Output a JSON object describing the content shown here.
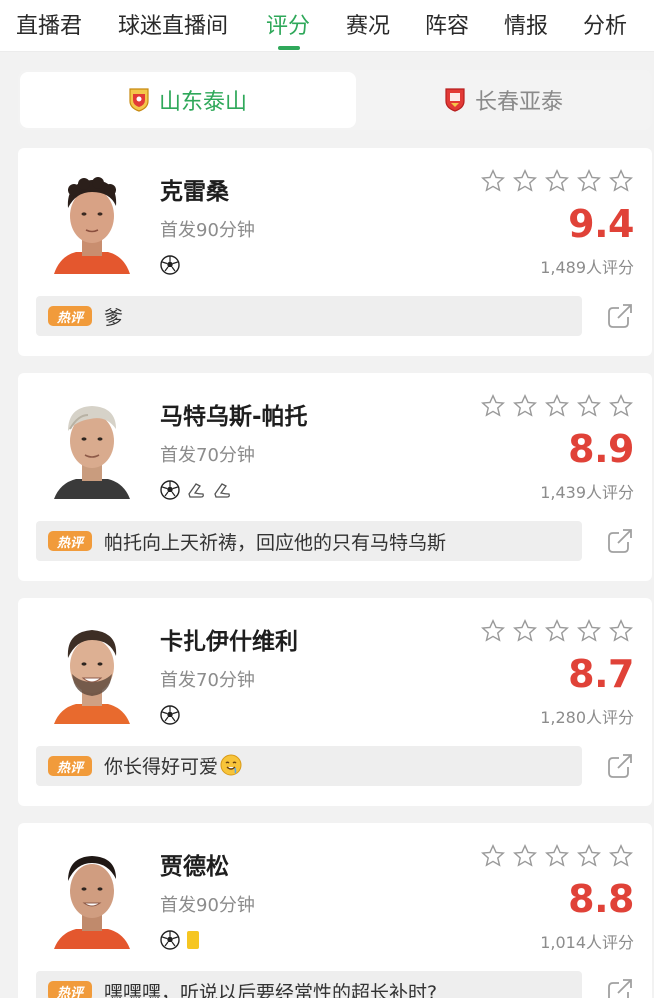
{
  "nav": {
    "tabs": [
      {
        "label": "直播君",
        "active": false
      },
      {
        "label": "球迷直播间",
        "active": false
      },
      {
        "label": "评分",
        "active": true
      },
      {
        "label": "赛况",
        "active": false
      },
      {
        "label": "阵容",
        "active": false
      },
      {
        "label": "情报",
        "active": false
      },
      {
        "label": "分析",
        "active": false
      }
    ],
    "accent_color": "#2fa85a"
  },
  "teams": {
    "home": {
      "name": "山东泰山",
      "selected": true,
      "badge_color": "#e8a21a"
    },
    "away": {
      "name": "长春亚泰",
      "selected": false,
      "badge_color": "#e23a36"
    }
  },
  "players": [
    {
      "name": "克雷桑",
      "start": "首发90分钟",
      "score": "9.4",
      "rating_count": "1,489人评分",
      "stars": 0,
      "icons": [
        "ball-icon"
      ],
      "hot_label": "热评",
      "hot_comment": "爹",
      "emoji": ""
    },
    {
      "name": "马特乌斯-帕托",
      "start": "首发70分钟",
      "score": "8.9",
      "rating_count": "1,439人评分",
      "stars": 0,
      "icons": [
        "ball-icon",
        "boot-icon",
        "boot-icon"
      ],
      "hot_label": "热评",
      "hot_comment": "帕托向上天祈祷，回应他的只有马特乌斯",
      "emoji": ""
    },
    {
      "name": "卡扎伊什维利",
      "start": "首发70分钟",
      "score": "8.7",
      "rating_count": "1,280人评分",
      "stars": 0,
      "icons": [
        "ball-icon"
      ],
      "hot_label": "热评",
      "hot_comment": "你长得好可爱",
      "emoji": "🤤"
    },
    {
      "name": "贾德松",
      "start": "首发90分钟",
      "score": "8.8",
      "rating_count": "1,014人评分",
      "stars": 0,
      "icons": [
        "ball-icon",
        "yellow-card-icon"
      ],
      "hot_label": "热评",
      "hot_comment": "嘿嘿嘿，听说以后要经常性的超长补时?",
      "emoji": ""
    }
  ],
  "colors": {
    "score": "#e04238",
    "hot_tag": "#f19b3b",
    "star_outline": "#9a9a9a"
  }
}
